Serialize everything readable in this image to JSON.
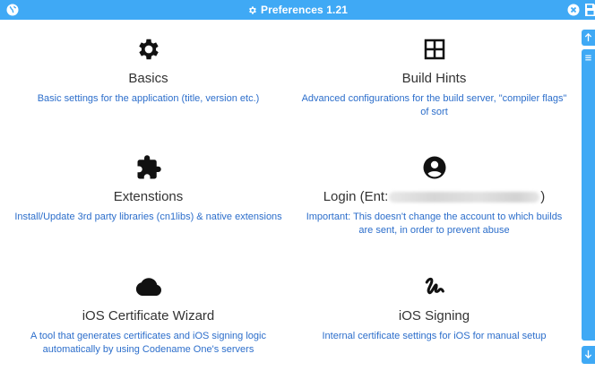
{
  "window": {
    "title": "Preferences 1.21"
  },
  "colors": {
    "accent": "#3fa9f5",
    "link_text": "#2c6ecb",
    "label_text": "#333333"
  },
  "items": [
    {
      "icon": "gear-icon",
      "label": "Basics",
      "description": "Basic settings for the application (title, version etc.)"
    },
    {
      "icon": "grid-icon",
      "label": "Build Hints",
      "description": "Advanced configurations for the build server, \"compiler flags\" of sort"
    },
    {
      "icon": "puzzle-icon",
      "label": "Extenstions",
      "description": "Install/Update 3rd party libraries (cn1libs) & native extensions"
    },
    {
      "icon": "account-circle-icon",
      "label_prefix": "Login (Ent:",
      "label_suffix": ")",
      "description": "Important: This doesn't change the account to which builds are sent, in order to prevent abuse"
    },
    {
      "icon": "cloud-icon",
      "label": "iOS Certificate Wizard",
      "description": "A tool that generates certificates and iOS signing logic automatically by using Codename One's servers"
    },
    {
      "icon": "signature-icon",
      "label": "iOS Signing",
      "description": "Internal certificate settings for iOS for manual setup"
    }
  ]
}
